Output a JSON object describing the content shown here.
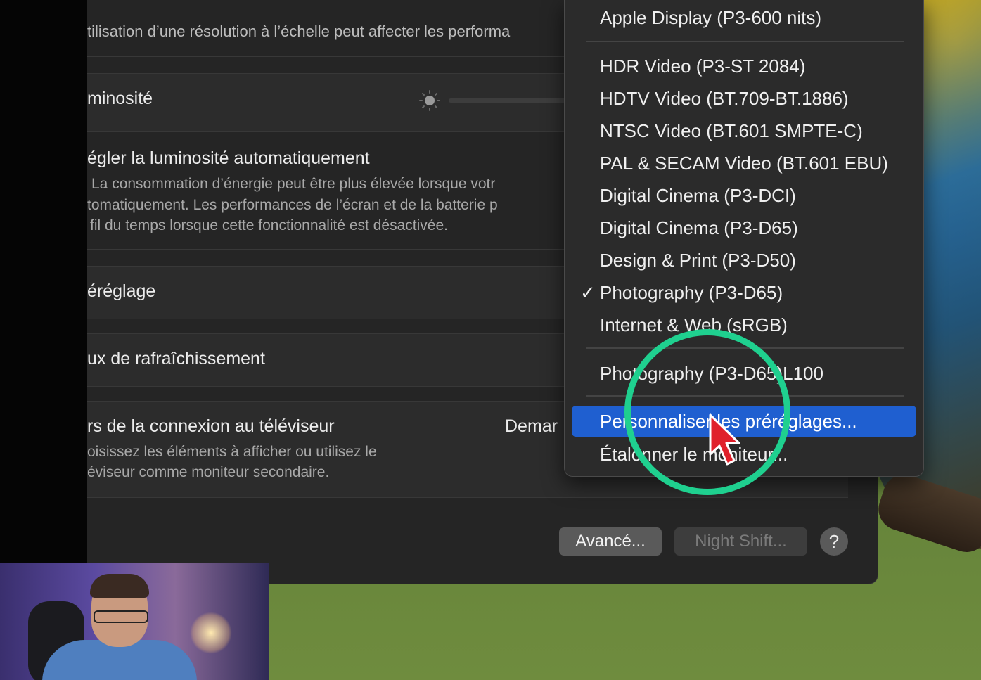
{
  "settings": {
    "resolution_note": "tilisation d’une résolution à l’échelle peut affecter les performa",
    "brightness_label": "minosité",
    "auto_brightness_label": "égler la luminosité automatiquement",
    "auto_brightness_desc_1": "La consommation d’énergie peut être plus élevée lorsque votr",
    "auto_brightness_desc_2": "tomatiquement. Les performances de l’écran et de la batterie p",
    "auto_brightness_desc_3": "fil du temps lorsque cette fonctionnalité est désactivée.",
    "preset_label": "éréglage",
    "refresh_rate_label": "ux de rafraîchissement",
    "tv_connection_label": "rs de la connexion au téléviseur",
    "tv_connection_value": "Demar",
    "tv_connection_desc_1": "oisissez les éléments à afficher ou utilisez le",
    "tv_connection_desc_2": "éviseur comme moniteur secondaire.",
    "advanced_button": "Avancé...",
    "night_shift_button": "Night Shift...",
    "help_button": "?"
  },
  "preset_menu": {
    "items": [
      {
        "label": "Apple Display (P3-600 nits)",
        "checked": false
      },
      {
        "label": "HDR Video (P3-ST 2084)",
        "checked": false
      },
      {
        "label": "HDTV Video (BT.709-BT.1886)",
        "checked": false
      },
      {
        "label": "NTSC Video (BT.601 SMPTE-C)",
        "checked": false
      },
      {
        "label": "PAL & SECAM Video (BT.601 EBU)",
        "checked": false
      },
      {
        "label": "Digital Cinema (P3-DCI)",
        "checked": false
      },
      {
        "label": "Digital Cinema (P3-D65)",
        "checked": false
      },
      {
        "label": "Design & Print (P3-D50)",
        "checked": false
      },
      {
        "label": "Photography (P3-D65)",
        "checked": true
      },
      {
        "label": "Internet & Web (sRGB)",
        "checked": false
      },
      {
        "label": "Photography (P3-D65)L100",
        "checked": false
      },
      {
        "label": "Personnaliser les préréglages...",
        "checked": false,
        "highlighted": true
      },
      {
        "label": "Étalonner le moniteur...",
        "checked": false
      }
    ],
    "check_mark": "✓"
  },
  "colors": {
    "highlight": "#1f5fd0",
    "annotation_ring": "#1fd08f",
    "cursor": "#e0202a"
  }
}
